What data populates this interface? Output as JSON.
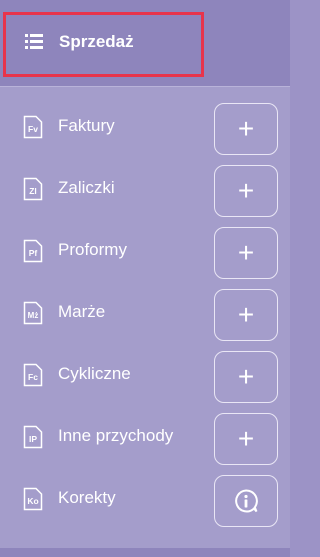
{
  "header": {
    "title": "Sprzedaż",
    "icon": "list-icon"
  },
  "items": [
    {
      "label": "Faktury",
      "code": "Fv",
      "action": "plus"
    },
    {
      "label": "Zaliczki",
      "code": "Zl",
      "action": "plus"
    },
    {
      "label": "Proformy",
      "code": "Pf",
      "action": "plus"
    },
    {
      "label": "Marże",
      "code": "Mż",
      "action": "plus"
    },
    {
      "label": "Cykliczne",
      "code": "Fc",
      "action": "plus"
    },
    {
      "label": "Inne przychody",
      "code": "IP",
      "action": "plus"
    },
    {
      "label": "Korekty",
      "code": "Ko",
      "action": "info"
    }
  ],
  "colors": {
    "header_bg": "#8e85bc",
    "panel_bg": "#a49dcb",
    "highlight": "#e8344b",
    "text": "#ffffff"
  }
}
